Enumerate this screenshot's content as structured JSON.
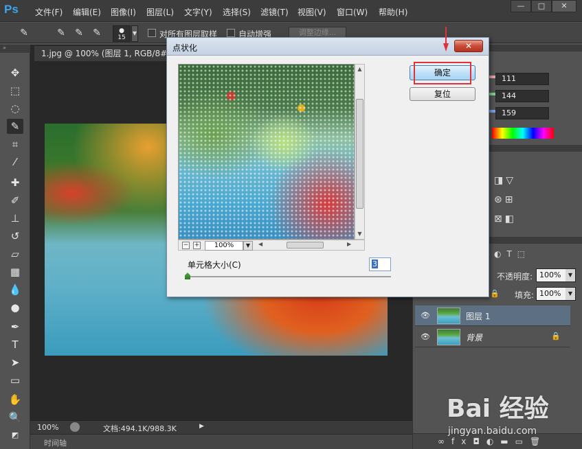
{
  "app": {
    "logo": "Ps"
  },
  "menu": [
    "文件(F)",
    "编辑(E)",
    "图像(I)",
    "图层(L)",
    "文字(Y)",
    "选择(S)",
    "滤镜(T)",
    "视图(V)",
    "窗口(W)",
    "帮助(H)"
  ],
  "window_buttons": {
    "minimize": "—",
    "maximize": "□",
    "close": "✕"
  },
  "options": {
    "brush_size": "15",
    "sample_all_layers": "对所有图层取样",
    "auto_enhance": "自动增强",
    "refine_edge": "调整边缘..."
  },
  "document": {
    "tab_title": "1.jpg @ 100% (图层 1, RGB/8#) *",
    "zoom": "100%",
    "doc_size": "文档:494.1K/988.3K",
    "timeline": "时间轴"
  },
  "color_panel": {
    "r": "111",
    "g": "144",
    "b": "159",
    "r_color": "#e8a0a8",
    "g_color": "#7fd08a",
    "b_color": "#7aa0e0"
  },
  "layers_panel": {
    "opacity_label": "不透明度:",
    "opacity_value": "100%",
    "fill_label": "填充:",
    "fill_value": "100%",
    "layers": [
      {
        "name": "图层 1",
        "selected": true
      },
      {
        "name": "背景",
        "selected": false,
        "locked": true
      }
    ]
  },
  "dialog": {
    "title": "点状化",
    "close": "✕",
    "ok": "确定",
    "reset": "复位",
    "preview_zoom": "100%",
    "cell_size_label": "单元格大小(C)",
    "cell_size_value": "3"
  },
  "watermark": {
    "logo": "Bai 经验",
    "url": "jingyan.baidu.com"
  }
}
